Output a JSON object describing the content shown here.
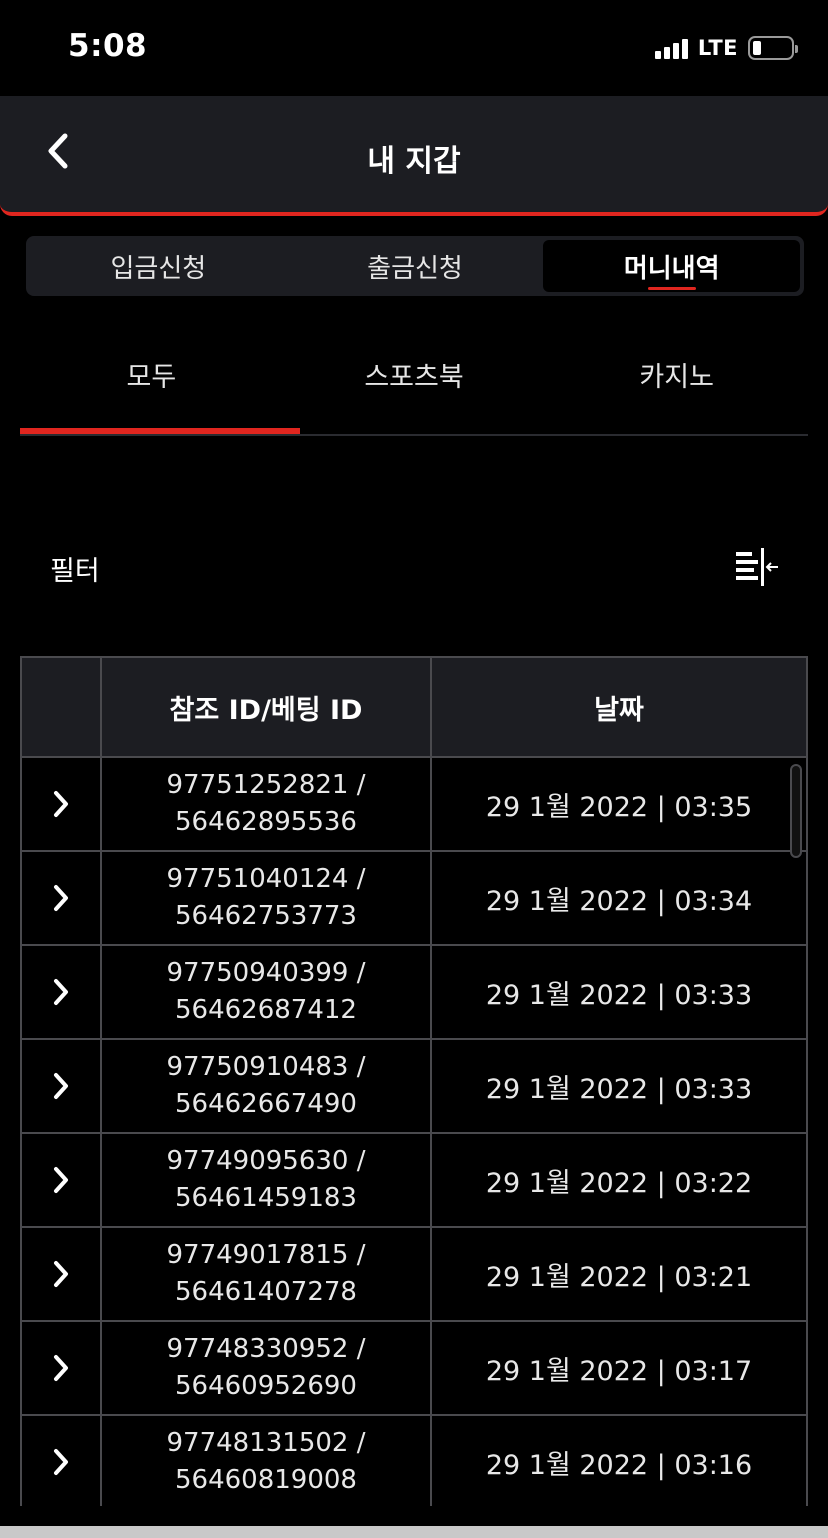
{
  "status_bar": {
    "time": "5:08",
    "network": "LTE"
  },
  "header": {
    "title": "내 지갑"
  },
  "segment_tabs": [
    {
      "label": "입금신청",
      "active": false
    },
    {
      "label": "출금신청",
      "active": false
    },
    {
      "label": "머니내역",
      "active": true
    }
  ],
  "category_tabs": [
    {
      "label": "모두",
      "active": true
    },
    {
      "label": "스포츠북",
      "active": false
    },
    {
      "label": "카지노",
      "active": false
    }
  ],
  "filter": {
    "label": "필터"
  },
  "table": {
    "headers": {
      "id": "참조 ID/베팅 ID",
      "date": "날짜"
    },
    "rows": [
      {
        "ref_id": "97751252821 /",
        "bet_id": "56462895536",
        "date": "29 1월 2022 | 03:35"
      },
      {
        "ref_id": "97751040124 /",
        "bet_id": "56462753773",
        "date": "29 1월 2022 | 03:34"
      },
      {
        "ref_id": "97750940399 /",
        "bet_id": "56462687412",
        "date": "29 1월 2022 | 03:33"
      },
      {
        "ref_id": "97750910483 /",
        "bet_id": "56462667490",
        "date": "29 1월 2022 | 03:33"
      },
      {
        "ref_id": "97749095630 /",
        "bet_id": "56461459183",
        "date": "29 1월 2022 | 03:22"
      },
      {
        "ref_id": "97749017815 /",
        "bet_id": "56461407278",
        "date": "29 1월 2022 | 03:21"
      },
      {
        "ref_id": "97748330952 /",
        "bet_id": "56460952690",
        "date": "29 1월 2022 | 03:17"
      },
      {
        "ref_id": "97748131502 /",
        "bet_id": "56460819008",
        "date": "29 1월 2022 | 03:16"
      }
    ]
  },
  "colors": {
    "accent": "#e0261f",
    "surface": "#1c1d22",
    "background": "#000000",
    "border": "#4a4a4e"
  }
}
